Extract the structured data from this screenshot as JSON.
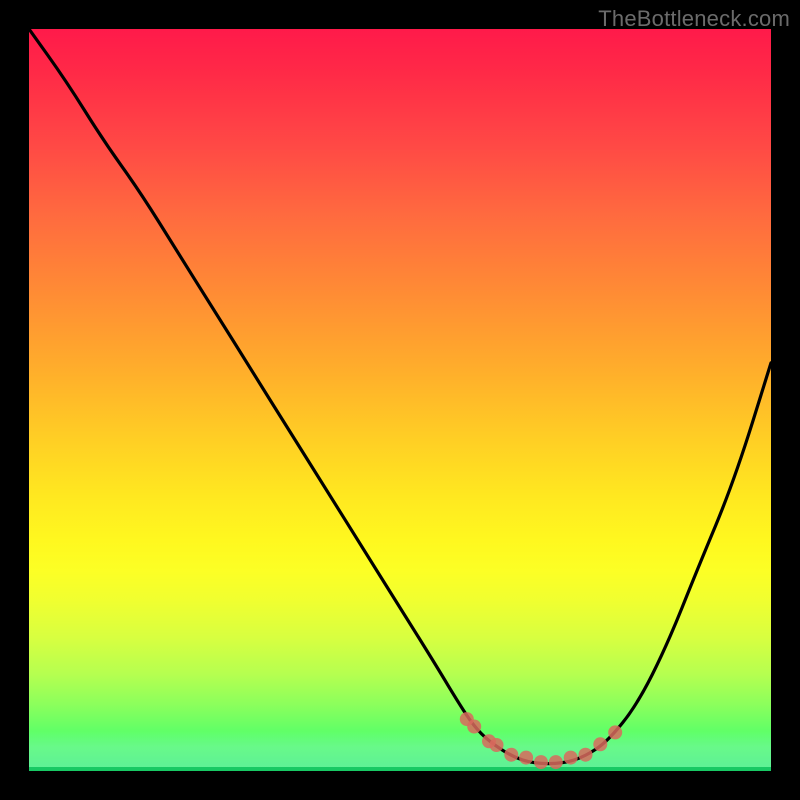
{
  "watermark": {
    "text": "TheBottleneck.com"
  },
  "chart_data": {
    "type": "line",
    "title": "",
    "xlabel": "",
    "ylabel": "",
    "xlim": [
      0,
      100
    ],
    "ylim": [
      0,
      100
    ],
    "grid": false,
    "legend": false,
    "background_gradient": {
      "top": "#ff1a4a",
      "mid": "#fff81f",
      "bottom": "#25e86e"
    },
    "series": [
      {
        "name": "bottleneck-curve",
        "color": "#000000",
        "x": [
          0,
          5,
          10,
          15,
          20,
          25,
          30,
          35,
          40,
          45,
          50,
          55,
          58,
          60,
          62,
          65,
          68,
          72,
          75,
          78,
          82,
          86,
          90,
          95,
          100
        ],
        "y": [
          100,
          93,
          85,
          78,
          70,
          62,
          54,
          46,
          38,
          30,
          22,
          14,
          9,
          6,
          4,
          2,
          1,
          1,
          2,
          4,
          9,
          17,
          27,
          39,
          55
        ]
      }
    ],
    "markers": {
      "name": "valley-dots",
      "color": "#d86a5d",
      "radius_px_viewport": 7,
      "points": [
        {
          "x": 59,
          "y": 7.0
        },
        {
          "x": 60,
          "y": 6.0
        },
        {
          "x": 62,
          "y": 4.0
        },
        {
          "x": 63,
          "y": 3.5
        },
        {
          "x": 65,
          "y": 2.2
        },
        {
          "x": 67,
          "y": 1.8
        },
        {
          "x": 69,
          "y": 1.2
        },
        {
          "x": 71,
          "y": 1.2
        },
        {
          "x": 73,
          "y": 1.8
        },
        {
          "x": 75,
          "y": 2.2
        },
        {
          "x": 77,
          "y": 3.6
        },
        {
          "x": 79,
          "y": 5.2
        }
      ]
    }
  }
}
